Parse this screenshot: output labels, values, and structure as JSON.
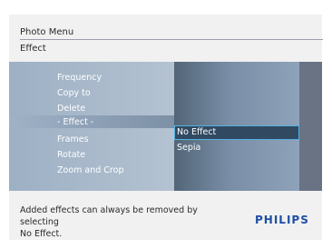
{
  "header": {
    "title": "Photo Menu",
    "subtitle": "Effect"
  },
  "main_menu": {
    "items": [
      {
        "label": "Frequency"
      },
      {
        "label": "Copy to"
      },
      {
        "label": "Delete"
      },
      {
        "label": "- Effect -"
      },
      {
        "label": "Frames"
      },
      {
        "label": "Rotate"
      },
      {
        "label": "Zoom and Crop"
      }
    ],
    "selected_index": 3
  },
  "submenu": {
    "items": [
      {
        "label": "No Effect"
      },
      {
        "label": "Sepia"
      }
    ],
    "selected_index": 0
  },
  "footer": {
    "line1": "Added effects can always be removed by selecting",
    "line2": "No Effect.",
    "logo": "PHILIPS"
  },
  "colors": {
    "logo": "#1e4fa3",
    "selection_border": "#55b0e0"
  }
}
